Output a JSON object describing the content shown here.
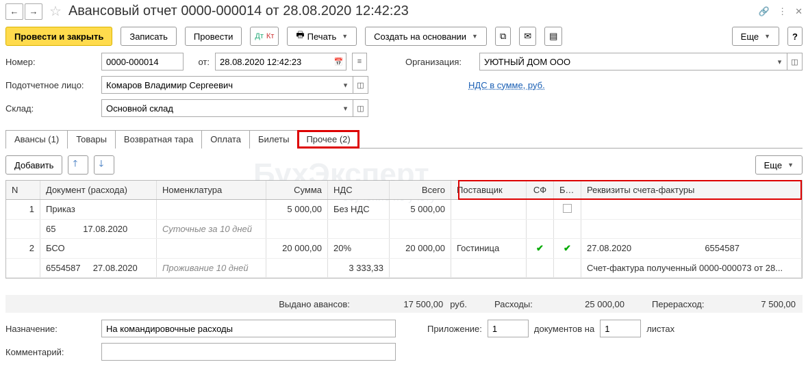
{
  "title": "Авансовый отчет 0000-000014 от 28.08.2020 12:42:23",
  "toolbar": {
    "post_close": "Провести и закрыть",
    "save": "Записать",
    "post": "Провести",
    "print": "Печать",
    "create_based": "Создать на основании",
    "more": "Еще",
    "help": "?"
  },
  "fields": {
    "number_label": "Номер:",
    "number": "0000-000014",
    "date_label": "от:",
    "date": "28.08.2020 12:42:23",
    "org_label": "Организация:",
    "org": "УЮТНЫЙ ДОМ ООО",
    "person_label": "Подотчетное лицо:",
    "person": "Комаров Владимир Сергеевич",
    "vat_link": "НДС в сумме, руб.",
    "warehouse_label": "Склад:",
    "warehouse": "Основной склад"
  },
  "tabs": {
    "t0": "Авансы (1)",
    "t1": "Товары",
    "t2": "Возвратная тара",
    "t3": "Оплата",
    "t4": "Билеты",
    "t5": "Прочее (2)"
  },
  "panel": {
    "add": "Добавить",
    "more": "Еще"
  },
  "grid": {
    "head": {
      "n": "N",
      "doc": "Документ (расхода)",
      "nom": "Номенклатура",
      "sum": "Сумма",
      "nds": "НДС",
      "total": "Всего",
      "sup": "Поставщик",
      "sf": "СФ",
      "bso": "БСО",
      "req": "Реквизиты счета-фактуры"
    },
    "rows": [
      {
        "n": "1",
        "doc": "Приказ",
        "doc_no": "65",
        "doc_date": "17.08.2020",
        "nom": "Суточные за 10 дней",
        "sum": "5 000,00",
        "nds": "Без НДС",
        "nds_amt": "",
        "total": "5 000,00",
        "sup": "",
        "sf": false,
        "bso_icon": "box",
        "req_date": "",
        "req_no": "",
        "req_doc": ""
      },
      {
        "n": "2",
        "doc": "БСО",
        "doc_no": "6554587",
        "doc_date": "27.08.2020",
        "nom": "Проживание 10 дней",
        "sum": "20 000,00",
        "nds": "20%",
        "nds_amt": "3 333,33",
        "total": "20 000,00",
        "sup": "Гостиница",
        "sf": true,
        "bso": true,
        "req_date": "27.08.2020",
        "req_no": "6554587",
        "req_doc": "Счет-фактура полученный 0000-000073 от 28..."
      }
    ]
  },
  "totals": {
    "issued_label": "Выдано авансов:",
    "issued": "17 500,00",
    "currency": "руб.",
    "spent_label": "Расходы:",
    "spent": "25 000,00",
    "over_label": "Перерасход:",
    "over": "7 500,00"
  },
  "footer": {
    "purpose_label": "Назначение:",
    "purpose": "На командировочные расходы",
    "attach_label": "Приложение:",
    "attach_count": "1",
    "docs_on": "документов на",
    "sheets": "1",
    "sheets_label": "листах",
    "comment_label": "Комментарий:",
    "comment": ""
  }
}
